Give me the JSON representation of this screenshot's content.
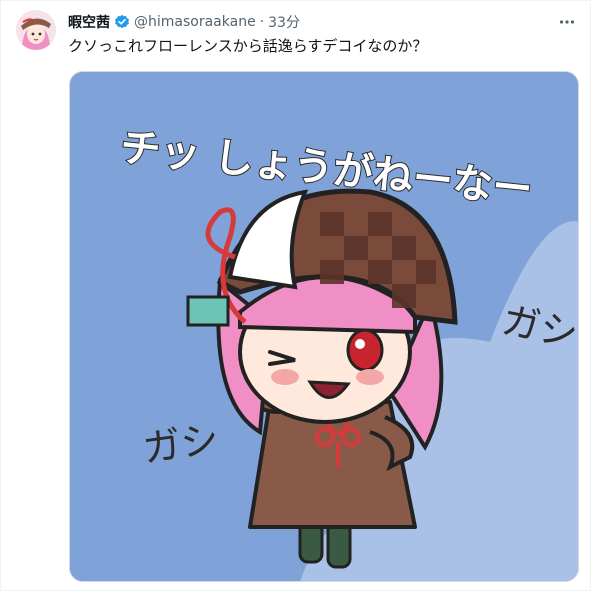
{
  "tweet": {
    "display_name": "暇空茜",
    "handle": "@himasoraakane",
    "separator": "·",
    "time": "33分",
    "text": "クソっこれフローレンスから話逸らすデコイなのか？",
    "more_icon": "more-horizontal-icon"
  },
  "image": {
    "caption_top": "チッ しょうがねーなー",
    "sfx_1": "ガシ",
    "sfx_2": "ガシ"
  },
  "colors": {
    "bg_blue": "#7fa3d9",
    "cloud": "#a9c1e6",
    "accent_verified": "#1d9bf0",
    "hair_pink": "#ef8fc6",
    "coat_brown": "#8a5a49"
  }
}
